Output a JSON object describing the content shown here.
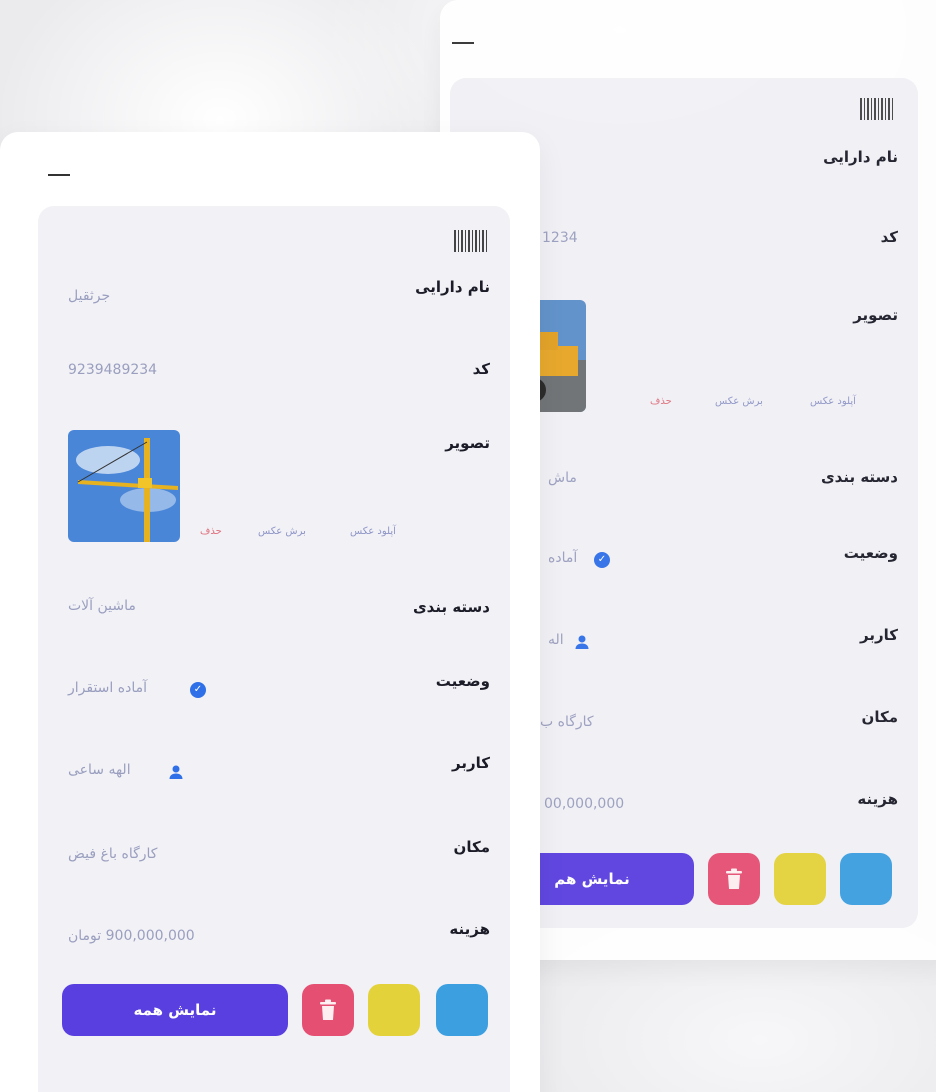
{
  "labels": {
    "asset_name": "نام دارایی",
    "code": "کد",
    "image": "تصویر",
    "category": "دسته بندی",
    "status": "وضعیت",
    "user": "کاربر",
    "location": "مکان",
    "cost": "هزینه"
  },
  "image_actions": {
    "upload": "آپلود عکس",
    "crop": "برش عکس",
    "delete": "حذف"
  },
  "show_all_label": "نمایش همه",
  "front_card": {
    "asset_name": "جرثقیل",
    "code": "9239489234",
    "category": "ماشین آلات",
    "status": "آماده استقرار",
    "user": "الهه ساعی",
    "location": "کارگاه باغ فیض",
    "cost": "900,000,000 تومان"
  },
  "back_card": {
    "code": "1234",
    "category": "ماش",
    "status": "آماده",
    "user": "اله",
    "location": "کارگاه ب",
    "cost": "00,000,000",
    "show_all_label": "نمایش هم"
  },
  "colors": {
    "primary": "#5a3fe0",
    "delete": "#e54f72",
    "yellow": "#e4d23a",
    "blue": "#3c9fe0",
    "status_icon": "#2f6fe8"
  },
  "icons": [
    "barcode-icon",
    "check-circle-icon",
    "user-icon",
    "trash-icon",
    "minimize-icon"
  ]
}
